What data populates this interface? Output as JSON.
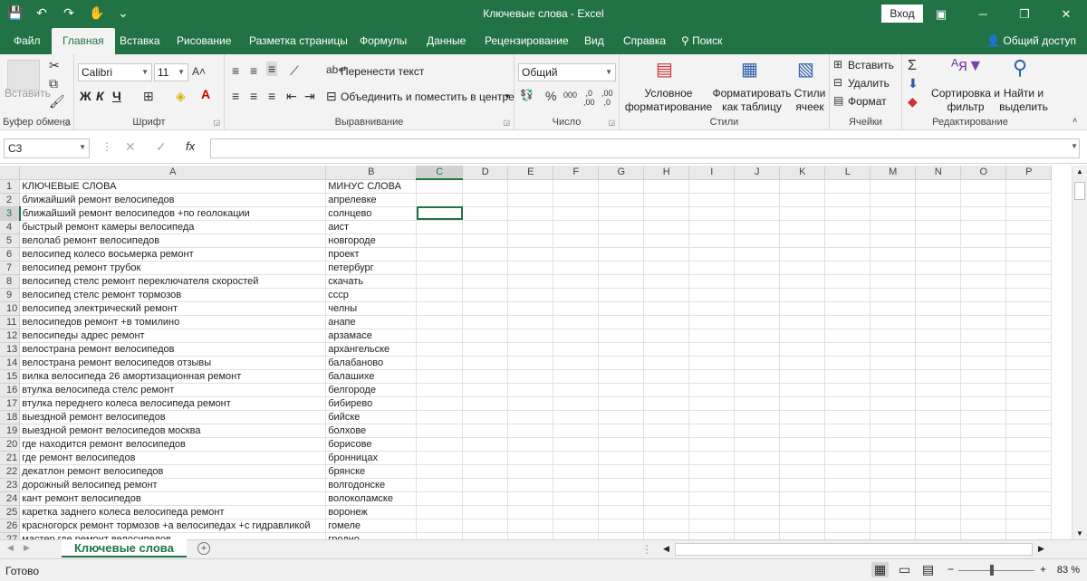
{
  "window": {
    "title": "Ключевые слова - Excel",
    "signin": "Вход"
  },
  "qat": {
    "save": "💾",
    "undo": "↶",
    "redo": "↷",
    "touch": "✋",
    "more": "⌄"
  },
  "tabs": [
    "Файл",
    "Главная",
    "Вставка",
    "Рисование",
    "Разметка страницы",
    "Формулы",
    "Данные",
    "Рецензирование",
    "Вид",
    "Справка"
  ],
  "tell_me": "Поиск",
  "share": "Общий доступ",
  "ribbon": {
    "clipboard": {
      "label": "Буфер обмена",
      "paste": "Вставить"
    },
    "font": {
      "label": "Шрифт",
      "name": "Calibri",
      "size": "11",
      "bold": "Ж",
      "italic": "К",
      "underline": "Ч"
    },
    "alignment": {
      "label": "Выравнивание",
      "wrap": "Перенести текст",
      "merge": "Объединить и поместить в центре"
    },
    "number": {
      "label": "Число",
      "format": "Общий"
    },
    "styles": {
      "label": "Стили",
      "conditional": "Условное форматирование",
      "table": "Форматировать как таблицу",
      "cell": "Стили ячеек"
    },
    "cells": {
      "label": "Ячейки",
      "insert": "Вставить",
      "delete": "Удалить",
      "format": "Формат"
    },
    "editing": {
      "label": "Редактирование",
      "sort": "Сортировка и фильтр",
      "find": "Найти и выделить"
    }
  },
  "namebox": "C3",
  "columns": [
    "A",
    "B",
    "C",
    "D",
    "E",
    "F",
    "G",
    "H",
    "I",
    "J",
    "K",
    "L",
    "M",
    "N",
    "O",
    "P"
  ],
  "rows": [
    [
      "КЛЮЧЕВЫЕ СЛОВА",
      "МИНУС СЛОВА"
    ],
    [
      "ближайший ремонт велосипедов",
      "апрелевке"
    ],
    [
      "ближайший ремонт велосипедов +по геолокации",
      "солнцево"
    ],
    [
      "быстрый ремонт камеры велосипеда",
      "аист"
    ],
    [
      "велолаб ремонт велосипедов",
      "новгороде"
    ],
    [
      "велосипед колесо восьмерка ремонт",
      "проект"
    ],
    [
      "велосипед ремонт трубок",
      "петербург"
    ],
    [
      "велосипед стелс ремонт переключателя скоростей",
      "скачать"
    ],
    [
      "велосипед стелс ремонт тормозов",
      "ссср"
    ],
    [
      "велосипед электрический ремонт",
      "челны"
    ],
    [
      "велосипедов ремонт +в томилино",
      "анапе"
    ],
    [
      "велосипеды адрес ремонт",
      "арзамасе"
    ],
    [
      "велострана ремонт велосипедов",
      "архангельске"
    ],
    [
      "велострана ремонт велосипедов отзывы",
      "балабаново"
    ],
    [
      "вилка велосипеда 26 амортизационная ремонт",
      "балашихе"
    ],
    [
      "втулка велосипеда стелс ремонт",
      "белгороде"
    ],
    [
      "втулка переднего колеса велосипеда ремонт",
      "бибирево"
    ],
    [
      "выездной ремонт велосипедов",
      "бийске"
    ],
    [
      "выездной ремонт велосипедов москва",
      "болхове"
    ],
    [
      "где находится ремонт велосипедов",
      "борисове"
    ],
    [
      "где ремонт велосипедов",
      "бронницах"
    ],
    [
      "декатлон ремонт велосипедов",
      "брянске"
    ],
    [
      "дорожный велосипед ремонт",
      "волгодонске"
    ],
    [
      "кант ремонт велосипедов",
      "волоколамске"
    ],
    [
      "каретка заднего колеса велосипеда ремонт",
      "воронеж"
    ],
    [
      "красногорск ремонт тормозов +а велосипедах +с гидравликой",
      "гомеле"
    ],
    [
      "мастер где ремонт велосипедов",
      "гродно"
    ]
  ],
  "sheet_tab": "Ключевые слова",
  "status": {
    "ready": "Готово",
    "zoom": "83 %"
  }
}
